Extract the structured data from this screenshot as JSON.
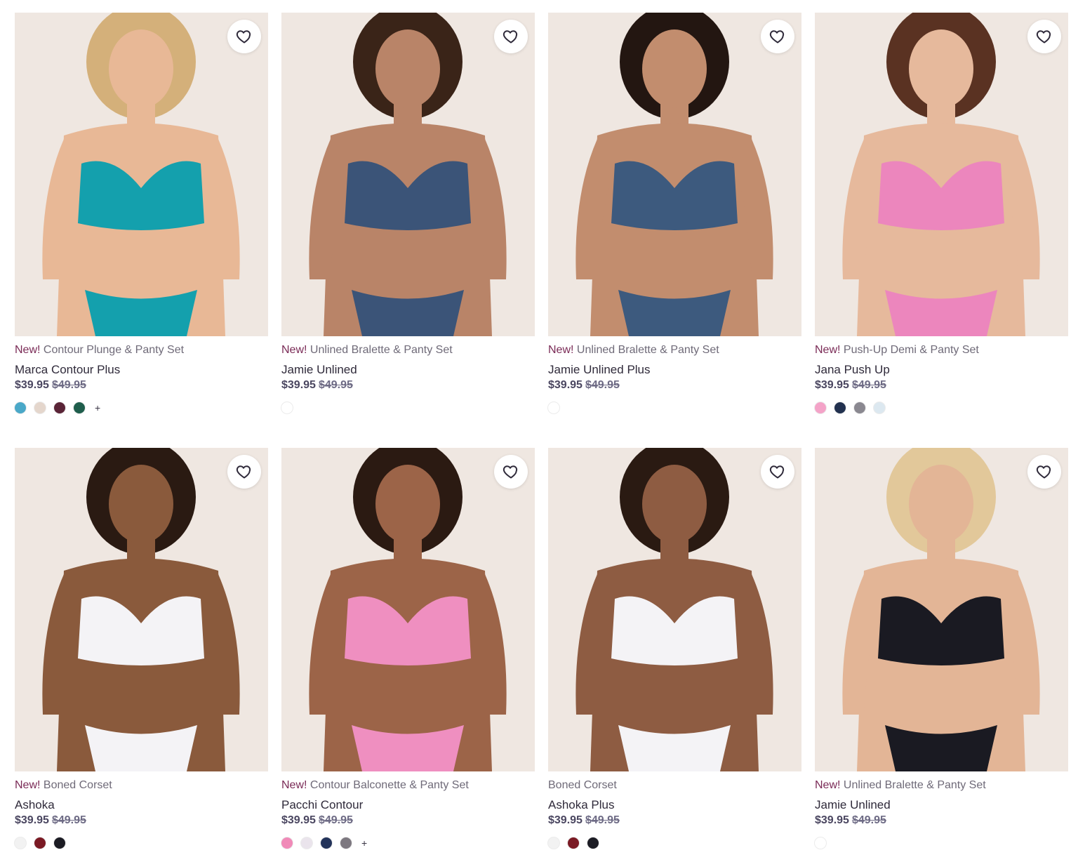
{
  "colors": {
    "new_accent": "#7a2a56",
    "price": "#4a4660",
    "image_bg": "#efe7e1"
  },
  "products": [
    {
      "badge": "New!",
      "subtitle": "Contour Plunge & Panty Set",
      "name": "Marca Contour Plus",
      "price": "$39.95",
      "original_price": "$49.95",
      "swatches": [
        "#4aa8c8",
        "#e4d6cc",
        "#5a2437",
        "#1f5e4c"
      ],
      "more": "+",
      "garment_color": "#14a0ad",
      "skin": "#e8b896",
      "hair": "#d4b07a",
      "wishlist_icon": "heart-icon"
    },
    {
      "badge": "New!",
      "subtitle": "Unlined Bralette & Panty Set",
      "name": "Jamie Unlined",
      "price": "$39.95",
      "original_price": "$49.95",
      "swatches": [
        "#ffffff"
      ],
      "more": "",
      "garment_color": "#3b5478",
      "skin": "#b98468",
      "hair": "#3a2418",
      "wishlist_icon": "heart-icon"
    },
    {
      "badge": "New!",
      "subtitle": "Unlined Bralette & Panty Set",
      "name": "Jamie Unlined Plus",
      "price": "$39.95",
      "original_price": "$49.95",
      "swatches": [
        "#ffffff"
      ],
      "more": "",
      "garment_color": "#3d5a7e",
      "skin": "#c28d6e",
      "hair": "#231611",
      "wishlist_icon": "heart-icon"
    },
    {
      "badge": "New!",
      "subtitle": "Push-Up Demi & Panty Set",
      "name": "Jana Push Up",
      "price": "$39.95",
      "original_price": "$49.95",
      "swatches": [
        "#f4a3c8",
        "#22314f",
        "#8a8890",
        "#dce8f0"
      ],
      "more": "",
      "garment_color": "#ec86bd",
      "skin": "#e6b99c",
      "hair": "#5a3222",
      "wishlist_icon": "heart-icon"
    },
    {
      "badge": "New!",
      "subtitle": "Boned Corset",
      "name": "Ashoka",
      "price": "$39.95",
      "original_price": "$49.95",
      "swatches": [
        "#f2f2f2",
        "#7a1a24",
        "#1c1c24"
      ],
      "more": "",
      "garment_color": "#f4f3f6",
      "skin": "#8a5a3c",
      "hair": "#2a1a12",
      "wishlist_icon": "heart-icon"
    },
    {
      "badge": "New!",
      "subtitle": "Contour Balconette & Panty Set",
      "name": "Pacchi Contour",
      "price": "$39.95",
      "original_price": "$49.95",
      "swatches": [
        "#f08ab8",
        "#eae4ec",
        "#23335a",
        "#7d7880"
      ],
      "more": "+",
      "garment_color": "#ef8fc0",
      "skin": "#9c6448",
      "hair": "#2b1a12",
      "wishlist_icon": "heart-icon"
    },
    {
      "badge": "",
      "subtitle": "Boned Corset",
      "name": "Ashoka Plus",
      "price": "$39.95",
      "original_price": "$49.95",
      "swatches": [
        "#f2f2f2",
        "#7a1a24",
        "#1c1c24"
      ],
      "more": "",
      "garment_color": "#f4f3f6",
      "skin": "#8e5c42",
      "hair": "#2a1a12",
      "wishlist_icon": "heart-icon"
    },
    {
      "badge": "New!",
      "subtitle": "Unlined Bralette & Panty Set",
      "name": "Jamie Unlined",
      "price": "$39.95",
      "original_price": "$49.95",
      "swatches": [
        "#ffffff"
      ],
      "more": "",
      "garment_color": "#1a1a22",
      "skin": "#e3b596",
      "hair": "#e2c89a",
      "wishlist_icon": "heart-icon"
    }
  ]
}
